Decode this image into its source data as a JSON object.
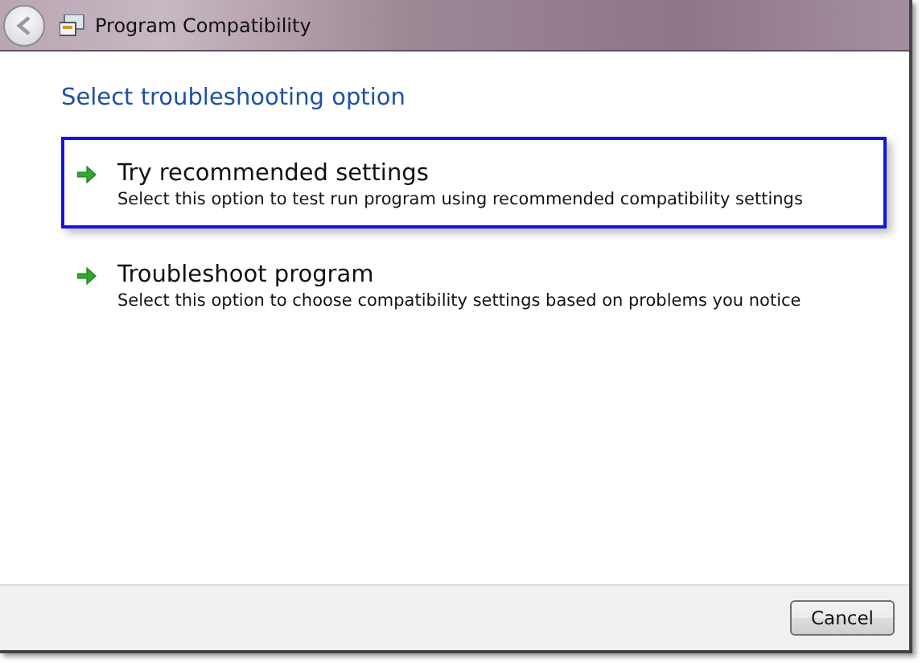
{
  "window": {
    "title": "Program Compatibility"
  },
  "heading": "Select troubleshooting option",
  "options": [
    {
      "title": "Try recommended settings",
      "description": "Select this option to test run program using recommended compatibility settings",
      "selected": true
    },
    {
      "title": "Troubleshoot program",
      "description": "Select this option to choose compatibility settings based on problems you notice",
      "selected": false
    }
  ],
  "buttons": [
    "Cancel"
  ]
}
